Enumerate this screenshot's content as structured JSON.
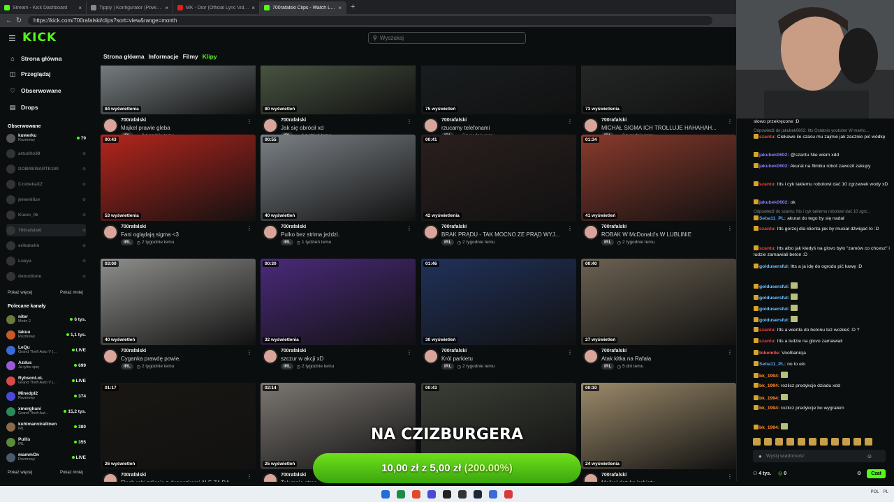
{
  "browser": {
    "tabs": [
      {
        "title": "Stream - Kick Dashboard",
        "fav": "#53fc18",
        "active": false
      },
      {
        "title": "Tipply | Konfigurator (Powiadomi...",
        "fav": "#888888",
        "active": false
      },
      {
        "title": "MK - Dior (Official Lyric Video) ft...",
        "fav": "#e0201a",
        "active": false
      },
      {
        "title": "700rafalski Clips - Watch Live on K...",
        "fav": "#53fc18",
        "active": true
      }
    ],
    "new_tab": "+",
    "close": "×",
    "url": "https://kick.com/700rafalski/clips?sort=view&range=month"
  },
  "header": {
    "logo": "KICK",
    "search_placeholder": "Wyszukaj"
  },
  "sidebar": {
    "nav": [
      {
        "label": "Strona główna",
        "icon": "⌂"
      },
      {
        "label": "Przeglądaj",
        "icon": "◫"
      },
      {
        "label": "Obserwowane",
        "icon": "♡"
      },
      {
        "label": "Drops",
        "icon": "▤"
      }
    ],
    "followed_header": "Obserwowane",
    "followed": [
      {
        "name": "kuwerku",
        "sub": "Rozmowy",
        "count": "79",
        "live": true
      },
      {
        "name": "artudito38",
        "sub": "",
        "count": "",
        "live": false
      },
      {
        "name": "DOBREWARTE100",
        "sub": "",
        "count": "",
        "live": false
      },
      {
        "name": "CzubekaXZ",
        "sub": "",
        "count": "",
        "live": false
      },
      {
        "name": "jemenilize",
        "sub": "",
        "count": "",
        "live": false
      },
      {
        "name": "Klaun_0k",
        "sub": "",
        "count": "",
        "live": false
      },
      {
        "name": "700rafalski",
        "sub": "",
        "count": "",
        "live": false
      },
      {
        "name": "erikahelin",
        "sub": "",
        "count": "",
        "live": false
      },
      {
        "name": "Loeya",
        "sub": "",
        "count": "",
        "live": false
      },
      {
        "name": "deiordione",
        "sub": "",
        "count": "",
        "live": false
      }
    ],
    "show_more": "Pokaż więcej",
    "show_less": "Pokaż mniej",
    "recommended_header": "Polecane kanały",
    "recommended": [
      {
        "name": "niter",
        "sub": "Metin 2",
        "count": "6 tys."
      },
      {
        "name": "takuu",
        "sub": "Rozmowy",
        "count": "1,1 tys."
      },
      {
        "name": "LeQu",
        "sub": "Grand Theft Auto V (...",
        "count": "LIVE"
      },
      {
        "name": "Azdus",
        "sub": "Ja tylko śpię",
        "count": "699"
      },
      {
        "name": "RybsonLoL",
        "sub": "Grand Theft Auto V (...",
        "count": "LIVE"
      },
      {
        "name": "Minedpl2",
        "sub": "Rozmowy",
        "count": "374"
      },
      {
        "name": "xmerghani",
        "sub": "Grand Theft Aut...",
        "count": "15,2 tys."
      },
      {
        "name": "kuhlmanvirallinen",
        "sub": "IRL",
        "count": "380"
      },
      {
        "name": "Pullis",
        "sub": "IRL",
        "count": "355"
      },
      {
        "name": "mammOn",
        "sub": "Rozmowy",
        "count": "LIVE"
      }
    ]
  },
  "subnav": {
    "items": [
      "Strona główna",
      "Informacje",
      "Filmy",
      "Klipy"
    ],
    "active": "Klipy"
  },
  "clips": [
    {
      "dur": "",
      "views": "84 wyświetlenia",
      "channel": "700rafalski",
      "title": "Majkel prawie gleba",
      "tag": "IRL",
      "age": "3 tygodnie temu",
      "bg": "#9aa3a6"
    },
    {
      "dur": "",
      "views": "80 wyświetleń",
      "channel": "700rafalski",
      "title": "Jak się obrócił xd",
      "tag": "IRL",
      "age": "1 tydzień temu",
      "bg": "#5c6b52"
    },
    {
      "dur": "",
      "views": "75 wyświetleń",
      "channel": "700rafalski",
      "title": "rzucamy telefonami",
      "tag": "IRL",
      "age": "2 tygodnie temu",
      "bg": "#1c2124"
    },
    {
      "dur": "",
      "views": "73 wyświetlenia",
      "channel": "700rafalski",
      "title": "MICHAŁ SIGMA ICH TROLLUJE HAHAHAH...",
      "tag": "IRL",
      "age": "2 tygodnie temu",
      "bg": "#2b2e2d"
    },
    {
      "dur": "00:43",
      "views": "53 wyświetlenia",
      "channel": "700rafalski",
      "title": "Fani oglądają sigma <3",
      "tag": "IRL",
      "age": "2 tygodnie temu",
      "bg": "#b5251d"
    },
    {
      "dur": "00:55",
      "views": "40 wyświetleń",
      "channel": "700rafalski",
      "title": "Pulko bez strima jeździ.",
      "tag": "IRL",
      "age": "1 tydzień temu",
      "bg": "#7b8186"
    },
    {
      "dur": "00:41",
      "views": "42 wyświetlenia",
      "channel": "700rafalski",
      "title": "BRAK PRĄDU - TAK MOCNO ZE PRĄD WYJ...",
      "tag": "IRL",
      "age": "2 tygodnie temu",
      "bg": "#2a1f1e"
    },
    {
      "dur": "01:34",
      "views": "41 wyświetleń",
      "channel": "700rafalski",
      "title": "ROBAK W McDonald's W LUBLINIE",
      "tag": "IRL",
      "age": "2 tygodnie temu",
      "bg": "#8a3a2c"
    },
    {
      "dur": "03:00",
      "views": "40 wyświetleń",
      "channel": "700rafalski",
      "title": "Cyganka prawdę powie.",
      "tag": "IRL",
      "age": "2 tygodnie temu",
      "bg": "#8e8f8c"
    },
    {
      "dur": "00:30",
      "views": "32 wyświetlenia",
      "channel": "700rafalski",
      "title": "szczur w akcji xD",
      "tag": "IRL",
      "age": "2 tygodnie temu",
      "bg": "#4a2a7a"
    },
    {
      "dur": "01:46",
      "views": "30 wyświetleń",
      "channel": "700rafalski",
      "title": "Król parkietu",
      "tag": "IRL",
      "age": "2 tygodnie temu",
      "bg": "#20315a"
    },
    {
      "dur": "00:40",
      "views": "27 wyświetleń",
      "channel": "700rafalski",
      "title": "Atak kitka na Rafała",
      "tag": "IRL",
      "age": "5 dni temu",
      "bg": "#6c6252"
    },
    {
      "dur": "01:17",
      "views": "26 wyświetleń",
      "channel": "700rafalski",
      "title": "Flash robi zdjęcie z dupeczkami ALE ZA DA...",
      "tag": "IRL",
      "age": "",
      "bg": "#1a1712"
    },
    {
      "dur": "02:14",
      "views": "25 wyświetleń",
      "channel": "700rafalski",
      "title": "Tak mnie stras...",
      "tag": "IRL",
      "age": "",
      "bg": "#7c7772"
    },
    {
      "dur": "00:43",
      "views": "",
      "channel": "700rafalski",
      "title": "",
      "tag": "IRL",
      "age": "",
      "bg": "#3a3f35"
    },
    {
      "dur": "00:10",
      "views": "24 wyświetlenia",
      "channel": "700rafalski",
      "title": "Majkel dotyka kobiety",
      "tag": "IRL",
      "age": "",
      "bg": "#9c8a6a"
    }
  ],
  "overlay": {
    "title": "NA CZIZBURGERA",
    "amount": "10,00 zł",
    "of": "z",
    "goal": "5,00 zł",
    "percent": "(200.00%)"
  },
  "chat": {
    "lines": [
      {
        "kind": "msg",
        "user": "",
        "ucolor": "#eee",
        "text": "słowo przekręcone :D"
      },
      {
        "kind": "sys",
        "user": "",
        "ucolor": "#888",
        "text": "Odpowiedź do jakubek0602: Itts Ostatnio youtuber W matrio..."
      },
      {
        "kind": "msg",
        "user": "szantu:",
        "ucolor": "#ff3d3d",
        "text": "Ciekawe ile czasu mu zajmie jak zacznie pić wódkę"
      },
      {
        "kind": "msg",
        "user": "jakubek0602:",
        "ucolor": "#8a7dff",
        "text": "@szantu Nie wiem xdd"
      },
      {
        "kind": "msg",
        "user": "jakubek0602:",
        "ucolor": "#8a7dff",
        "text": "Akurat na filmiku robot zawoził zakupy"
      },
      {
        "kind": "msg",
        "user": "szantu:",
        "ucolor": "#ff3d3d",
        "text": "Itts i cyk takiemu robotowi dać 10 zgrzewek wody xD"
      },
      {
        "kind": "msg",
        "user": "jakubek0602:",
        "ucolor": "#8a7dff",
        "text": "ok"
      },
      {
        "kind": "sys",
        "user": "",
        "ucolor": "#888",
        "text": "Odpowiedź do szantu: Itts i cyk takiemu robotowi dać 10 zgrz..."
      },
      {
        "kind": "msg",
        "user": "Seba11_PL:",
        "ucolor": "#5aa7ff",
        "text": "akurat do tego by się nadał"
      },
      {
        "kind": "msg",
        "user": "szantu:",
        "ucolor": "#ff3d3d",
        "text": "Itts gorzej dla klienta jak by musiał dźwigać to :D"
      },
      {
        "kind": "msg",
        "user": "szantu:",
        "ucolor": "#ff3d3d",
        "text": "Itts albo jak kiedyś na glovo było \"zamów co chcesz\" i ludzie zamawiali beton :D"
      },
      {
        "kind": "msg",
        "user": "goldusersful:",
        "ucolor": "#6ec3ff",
        "text": "Itts a ja idę do ogrodu pić kawę :D"
      },
      {
        "kind": "msg",
        "user": "goldusersful:",
        "ucolor": "#6ec3ff",
        "text": ""
      },
      {
        "kind": "msg",
        "user": "goldusersful:",
        "ucolor": "#6ec3ff",
        "text": ""
      },
      {
        "kind": "msg",
        "user": "goldusersful:",
        "ucolor": "#6ec3ff",
        "text": ""
      },
      {
        "kind": "msg",
        "user": "goldusersful:",
        "ucolor": "#6ec3ff",
        "text": ""
      },
      {
        "kind": "msg",
        "user": "szantu:",
        "ucolor": "#ff3d3d",
        "text": "Itts a wiertła do betonu też woziłeś :D ?"
      },
      {
        "kind": "msg",
        "user": "szantu:",
        "ucolor": "#ff3d3d",
        "text": "Itts a ludzie na glovo zamawiali"
      },
      {
        "kind": "msg",
        "user": "tobemile:",
        "ucolor": "#ff5a5a",
        "text": "Voolbanicja"
      },
      {
        "kind": "msg",
        "user": "Seba11_PL:",
        "ucolor": "#5aa7ff",
        "text": "no to elo"
      },
      {
        "kind": "msg",
        "user": "bk_1994:",
        "ucolor": "#ff8a2a",
        "text": ""
      },
      {
        "kind": "msg",
        "user": "bk_1994:",
        "ucolor": "#ff8a2a",
        "text": "rozlicz predykcje dziadu xdd"
      },
      {
        "kind": "msg",
        "user": "bk_1994:",
        "ucolor": "#ff8a2a",
        "text": ""
      },
      {
        "kind": "msg",
        "user": "bk_1994:",
        "ucolor": "#ff8a2a",
        "text": "rozlicz predykcje bo wygrałem"
      },
      {
        "kind": "msg",
        "user": "bk_1994:",
        "ucolor": "#ff8a2a",
        "text": ""
      }
    ],
    "message_placeholder": "Wyślij wiadomość",
    "viewers": "4 tys.",
    "points": "0",
    "send_label": "Czat"
  },
  "taskbar": {
    "icons": [
      "#1e6fd8",
      "#1e8a4a",
      "#e04a2a",
      "#4a4ad8",
      "#222222",
      "#333333",
      "#1b2838",
      "#3a6ad8",
      "#d83a3a"
    ],
    "tray": [
      "POL",
      "PL"
    ]
  }
}
